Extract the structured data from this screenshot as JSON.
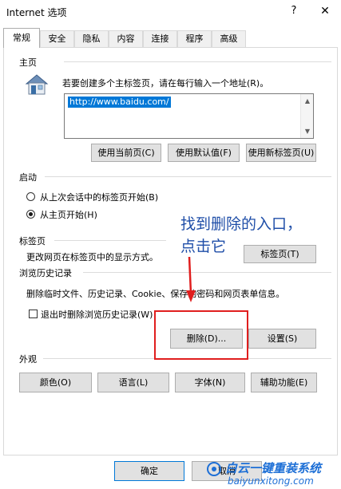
{
  "window": {
    "title": "Internet 选项",
    "help": "?",
    "close": "✕"
  },
  "tabs": [
    {
      "label": "常规",
      "active": true
    },
    {
      "label": "安全"
    },
    {
      "label": "隐私"
    },
    {
      "label": "内容"
    },
    {
      "label": "连接"
    },
    {
      "label": "程序"
    },
    {
      "label": "高级"
    }
  ],
  "homepage": {
    "section_title": "主页",
    "instruction": "若要创建多个主标签页，请在每行输入一个地址(R)。",
    "url": "http://www.baidu.com/",
    "icon": "house-icon",
    "buttons": {
      "use_current": "使用当前页(C)",
      "use_default": "使用默认值(F)",
      "use_new_tab": "使用新标签页(U)"
    }
  },
  "startup": {
    "section_title": "启动",
    "option_last_session": "从上次会话中的标签页开始(B)",
    "option_homepage": "从主页开始(H)",
    "selected": "option_homepage"
  },
  "tabs_section": {
    "section_title": "标签页",
    "description": "更改网页在标签页中的显示方式。",
    "button": "标签页(T)"
  },
  "history": {
    "section_title": "浏览历史记录",
    "description": "删除临时文件、历史记录、Cookie、保存的密码和网页表单信息。",
    "delete_on_exit": "退出时删除浏览历史记录(W)",
    "delete_on_exit_checked": false,
    "delete_button": "删除(D)...",
    "settings_button": "设置(S)"
  },
  "appearance": {
    "section_title": "外观",
    "buttons": {
      "colors": "颜色(O)",
      "languages": "语言(L)",
      "fonts": "字体(N)",
      "accessibility": "辅助功能(E)"
    }
  },
  "footer": {
    "ok": "确定",
    "cancel": "取消"
  },
  "annotation": {
    "line1": "找到删除的入口，",
    "line2": "点击它",
    "color": "#1f4ea8",
    "box_color": "#e01e1e"
  },
  "watermark": {
    "text": "白云一键重装系统",
    "url": "baiyunxitong.com"
  }
}
